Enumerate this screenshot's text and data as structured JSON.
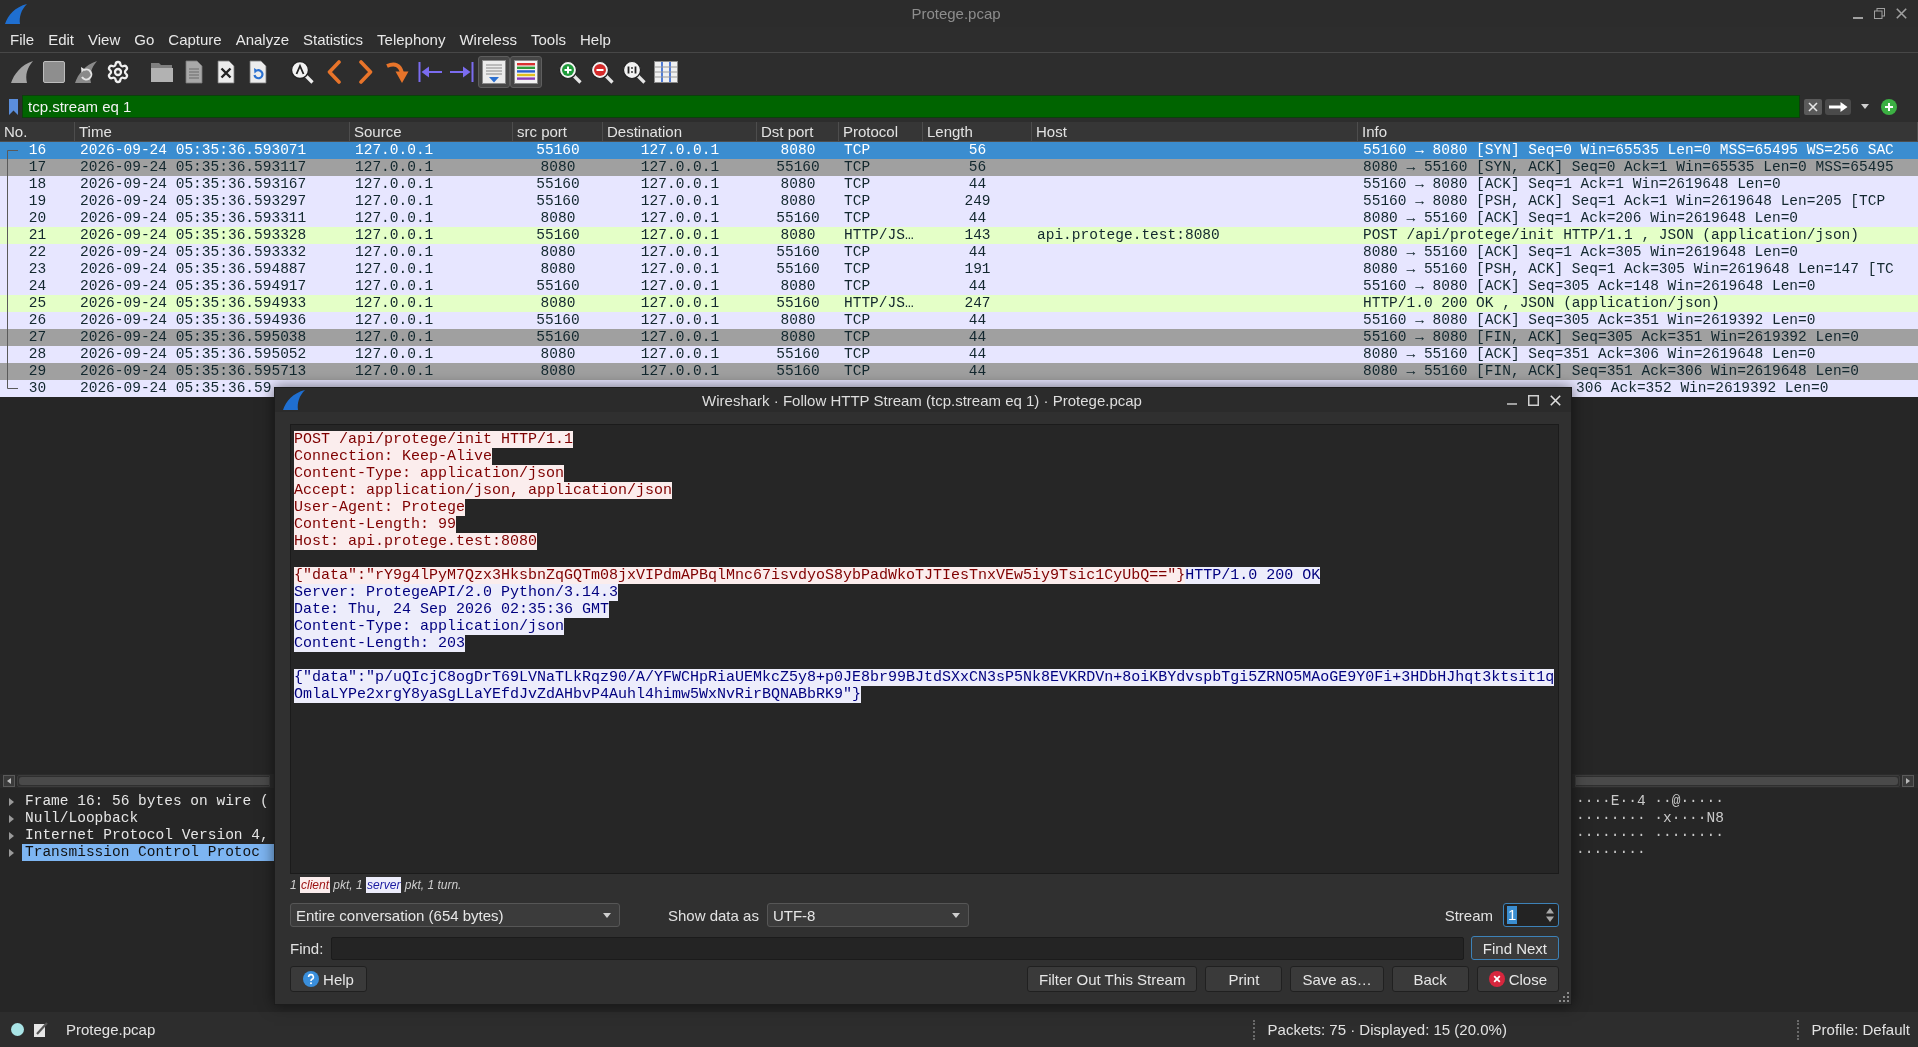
{
  "window": {
    "title": "Protege.pcap"
  },
  "menu": [
    "File",
    "Edit",
    "View",
    "Go",
    "Capture",
    "Analyze",
    "Statistics",
    "Telephony",
    "Wireless",
    "Tools",
    "Help"
  ],
  "toolbar": [
    {
      "buttons": [
        {
          "kind": "start",
          "on": false
        },
        {
          "kind": "stop",
          "on": false
        },
        {
          "kind": "restart",
          "on": false
        },
        {
          "kind": "options",
          "on": false
        }
      ]
    },
    {
      "buttons": [
        {
          "kind": "open",
          "on": false
        },
        {
          "kind": "save",
          "on": false
        },
        {
          "kind": "close",
          "on": false
        },
        {
          "kind": "reload",
          "on": false
        }
      ]
    },
    {
      "buttons": [
        {
          "kind": "find",
          "on": false
        },
        {
          "kind": "back",
          "on": false
        },
        {
          "kind": "forward",
          "on": false
        },
        {
          "kind": "jump",
          "on": false
        },
        {
          "kind": "first",
          "on": false
        },
        {
          "kind": "last",
          "on": false
        },
        {
          "kind": "autoscroll",
          "on": true
        },
        {
          "kind": "colorize",
          "on": true
        }
      ]
    },
    {
      "buttons": [
        {
          "kind": "zoom_in",
          "on": false
        },
        {
          "kind": "zoom_out",
          "on": false
        },
        {
          "kind": "zoom_reset",
          "on": false
        },
        {
          "kind": "resize_columns",
          "on": false
        }
      ]
    }
  ],
  "filter": {
    "value": "tcp.stream eq 1",
    "valid": true
  },
  "packet_list": {
    "columns": [
      "No.",
      "Time",
      "Source",
      "src port",
      "Destination",
      "Dst port",
      "Protocol",
      "Length",
      "Host",
      "Info"
    ],
    "rows": [
      {
        "kind": "full",
        "no": "16",
        "time": "2026-09-24 05:35:36.593071",
        "source": "127.0.0.1",
        "src_port": "55160",
        "destination": "127.0.0.1",
        "dst_port": "8080",
        "protocol": "TCP",
        "length": "56",
        "info": "55160 → 8080 [SYN] Seq=0 Win=65535 Len=0 MSS=65495 WS=256 SAC",
        "selected": true
      },
      {
        "kind": "full",
        "no": "17",
        "time": "2026-09-24 05:35:36.593117",
        "source": "127.0.0.1",
        "src_port": "8080",
        "destination": "127.0.0.1",
        "dst_port": "55160",
        "protocol": "TCP",
        "length": "56",
        "info": "8080 → 55160 [SYN, ACK] Seq=0 Ack=1 Win=65535 Len=0 MSS=65495",
        "color": "#a0a0a0",
        "selected": false
      },
      {
        "kind": "full",
        "no": "18",
        "time": "2026-09-24 05:35:36.593167",
        "source": "127.0.0.1",
        "src_port": "55160",
        "destination": "127.0.0.1",
        "dst_port": "8080",
        "protocol": "TCP",
        "length": "44",
        "info": "55160 → 8080 [ACK] Seq=1 Ack=1 Win=2619648 Len=0",
        "color": "#e7e6ff",
        "selected": false
      },
      {
        "kind": "full",
        "no": "19",
        "time": "2026-09-24 05:35:36.593297",
        "source": "127.0.0.1",
        "src_port": "55160",
        "destination": "127.0.0.1",
        "dst_port": "8080",
        "protocol": "TCP",
        "length": "249",
        "info": "55160 → 8080 [PSH, ACK] Seq=1 Ack=1 Win=2619648 Len=205 [TCP",
        "color": "#e7e6ff",
        "selected": false
      },
      {
        "kind": "full",
        "no": "20",
        "time": "2026-09-24 05:35:36.593311",
        "source": "127.0.0.1",
        "src_port": "8080",
        "destination": "127.0.0.1",
        "dst_port": "55160",
        "protocol": "TCP",
        "length": "44",
        "info": "8080 → 55160 [ACK] Seq=1 Ack=206 Win=2619648 Len=0",
        "color": "#e7e6ff",
        "selected": false
      },
      {
        "kind": "full",
        "no": "21",
        "time": "2026-09-24 05:35:36.593328",
        "source": "127.0.0.1",
        "src_port": "55160",
        "destination": "127.0.0.1",
        "dst_port": "8080",
        "protocol": "HTTP/JS…",
        "length": "143",
        "host": "api.protege.test:8080",
        "info": "POST /api/protege/init HTTP/1.1 , JSON (application/json)",
        "color": "#e4ffc7",
        "selected": false
      },
      {
        "kind": "full",
        "no": "22",
        "time": "2026-09-24 05:35:36.593332",
        "source": "127.0.0.1",
        "src_port": "8080",
        "destination": "127.0.0.1",
        "dst_port": "55160",
        "protocol": "TCP",
        "length": "44",
        "info": "8080 → 55160 [ACK] Seq=1 Ack=305 Win=2619648 Len=0",
        "color": "#e7e6ff",
        "selected": false
      },
      {
        "kind": "full",
        "no": "23",
        "time": "2026-09-24 05:35:36.594887",
        "source": "127.0.0.1",
        "src_port": "8080",
        "destination": "127.0.0.1",
        "dst_port": "55160",
        "protocol": "TCP",
        "length": "191",
        "info": "8080 → 55160 [PSH, ACK] Seq=1 Ack=305 Win=2619648 Len=147 [TC",
        "color": "#e7e6ff",
        "selected": false
      },
      {
        "kind": "full",
        "no": "24",
        "time": "2026-09-24 05:35:36.594917",
        "source": "127.0.0.1",
        "src_port": "55160",
        "destination": "127.0.0.1",
        "dst_port": "8080",
        "protocol": "TCP",
        "length": "44",
        "info": "55160 → 8080 [ACK] Seq=305 Ack=148 Win=2619648 Len=0",
        "color": "#e7e6ff",
        "selected": false
      },
      {
        "kind": "full",
        "no": "25",
        "time": "2026-09-24 05:35:36.594933",
        "source": "127.0.0.1",
        "src_port": "8080",
        "destination": "127.0.0.1",
        "dst_port": "55160",
        "protocol": "HTTP/JS…",
        "length": "247",
        "info": "HTTP/1.0 200 OK , JSON (application/json)",
        "color": "#e4ffc7",
        "selected": false
      },
      {
        "kind": "full",
        "no": "26",
        "time": "2026-09-24 05:35:36.594936",
        "source": "127.0.0.1",
        "src_port": "55160",
        "destination": "127.0.0.1",
        "dst_port": "8080",
        "protocol": "TCP",
        "length": "44",
        "info": "55160 → 8080 [ACK] Seq=305 Ack=351 Win=2619392 Len=0",
        "color": "#e7e6ff",
        "selected": false
      },
      {
        "kind": "full",
        "no": "27",
        "time": "2026-09-24 05:35:36.595038",
        "source": "127.0.0.1",
        "src_port": "55160",
        "destination": "127.0.0.1",
        "dst_port": "8080",
        "protocol": "TCP",
        "length": "44",
        "info": "55160 → 8080 [FIN, ACK] Seq=305 Ack=351 Win=2619392 Len=0",
        "color": "#a0a0a0",
        "selected": false
      },
      {
        "kind": "full",
        "no": "28",
        "time": "2026-09-24 05:35:36.595052",
        "source": "127.0.0.1",
        "src_port": "8080",
        "destination": "127.0.0.1",
        "dst_port": "55160",
        "protocol": "TCP",
        "length": "44",
        "info": "8080 → 55160 [ACK] Seq=351 Ack=306 Win=2619648 Len=0",
        "color": "#e7e6ff",
        "selected": false
      },
      {
        "kind": "full",
        "no": "29",
        "time": "2026-09-24 05:35:36.595713",
        "source": "127.0.0.1",
        "src_port": "8080",
        "destination": "127.0.0.1",
        "dst_port": "55160",
        "protocol": "TCP",
        "length": "44",
        "info": "8080 → 55160 [FIN, ACK] Seq=351 Ack=306 Win=2619648 Len=0",
        "color": "#a0a0a0",
        "selected": false
      },
      {
        "kind": "partial",
        "no": "30",
        "time": "2026-09-24 05:35:36.59",
        "info": "306 Ack=352 Win=2619392 Len=0",
        "color": "#e7e6ff",
        "selected": false
      }
    ]
  },
  "packet_details": [
    {
      "label": "Frame 16: 56 bytes on wire (",
      "expanded": false,
      "selected": false
    },
    {
      "label": "Null/Loopback",
      "expanded": false,
      "selected": false
    },
    {
      "label": "Internet Protocol Version 4,",
      "expanded": false,
      "selected": false
    },
    {
      "label": "Transmission Control Protoc",
      "expanded": false,
      "selected": true
    }
  ],
  "packet_bytes": {
    "ascii_lines": [
      "····E··4 ··@·····",
      "········ ·x····N8",
      "········ ········",
      "········"
    ]
  },
  "status_bar": {
    "file": "Protege.pcap",
    "packets": "Packets: 75 · Displayed: 15 (20.0%)",
    "profile": "Profile: Default"
  },
  "follow_dialog": {
    "title": "Wireshark · Follow HTTP Stream (tcp.stream eq 1) · Protege.pcap",
    "stream": [
      {
        "kind": "client",
        "text": "POST /api/protege/init HTTP/1.1\nConnection: Keep-Alive\nContent-Type: application/json\nAccept: application/json, application/json\nUser-Agent: Protege\nContent-Length: 99\nHost: api.protege.test:8080\n\n{\"data\":\"rY9g4lPyM7Qzx3HksbnZqGQTm08jxVIPdmAPBqlMnc67isvdyoS8ybPadWkoTJTIesTnxVEw5iy9Tsic1CyUbQ==\"}"
      },
      {
        "kind": "server",
        "text": "HTTP/1.0 200 OK\nServer: ProtegeAPI/2.0 Python/3.14.3\nDate: Thu, 24 Sep 2026 02:35:36 GMT\nContent-Type: application/json\nContent-Length: 203\n\n{\"data\":\"p/uQIcjC8ogDrT69LVNaTLkRqz90/A/YFWCHpRiaUEMkcZ5y8+p0JE8br99BJtdSXxCN3sP5Nk8EVKRDVn+8oiKBYdvspbTgi5ZRNO5MAoGE9Y0Fi+3HDbHJhqt3ktsit1qOmlaLYPe2xrgY8yaSgLLaYEfdJvZdAHbvP4Auhl4himw5WxNvRirBQNABbRK9\"}"
      }
    ],
    "summary": [
      {
        "kind": "plain",
        "text": "1 "
      },
      {
        "kind": "client",
        "text": "client"
      },
      {
        "kind": "plain",
        "text": " pkt, 1 "
      },
      {
        "kind": "server",
        "text": "server"
      },
      {
        "kind": "plain",
        "text": " pkt, 1 turn."
      }
    ],
    "conversation": {
      "value": "Entire conversation (654 bytes)"
    },
    "show_data_as": {
      "label": "Show data as",
      "value": "UTF-8"
    },
    "stream_number": {
      "label": "Stream",
      "value": "1",
      "focused": true
    },
    "find": {
      "label": "Find:"
    },
    "find_next": {
      "label": "Find Next",
      "default": true
    },
    "left_buttons": [
      {
        "label": "Help",
        "kind": "help"
      }
    ],
    "right_buttons": [
      {
        "label": "Filter Out This Stream",
        "kind": "plain"
      },
      {
        "label": "Print",
        "kind": "plain"
      },
      {
        "label": "Save as…",
        "kind": "plain"
      },
      {
        "label": "Back",
        "kind": "plain"
      },
      {
        "label": "Close",
        "kind": "close"
      }
    ]
  }
}
